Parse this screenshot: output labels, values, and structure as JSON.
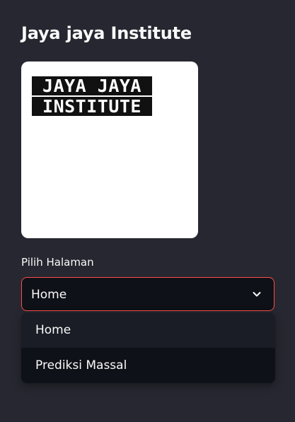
{
  "sidebar": {
    "title": "Jaya jaya Institute",
    "logo": {
      "line1": "JAYA JAYA",
      "line2": "INSTITUTE"
    },
    "page_select": {
      "label": "Pilih Halaman",
      "selected": "Home",
      "options": [
        "Home",
        "Prediksi Massal"
      ]
    }
  },
  "colors": {
    "background": "#262730",
    "select_border": "#ff4b4b",
    "input_background": "#0e1117",
    "text": "#fafafa"
  },
  "icons": {
    "dropdown": "chevron-down-icon"
  }
}
